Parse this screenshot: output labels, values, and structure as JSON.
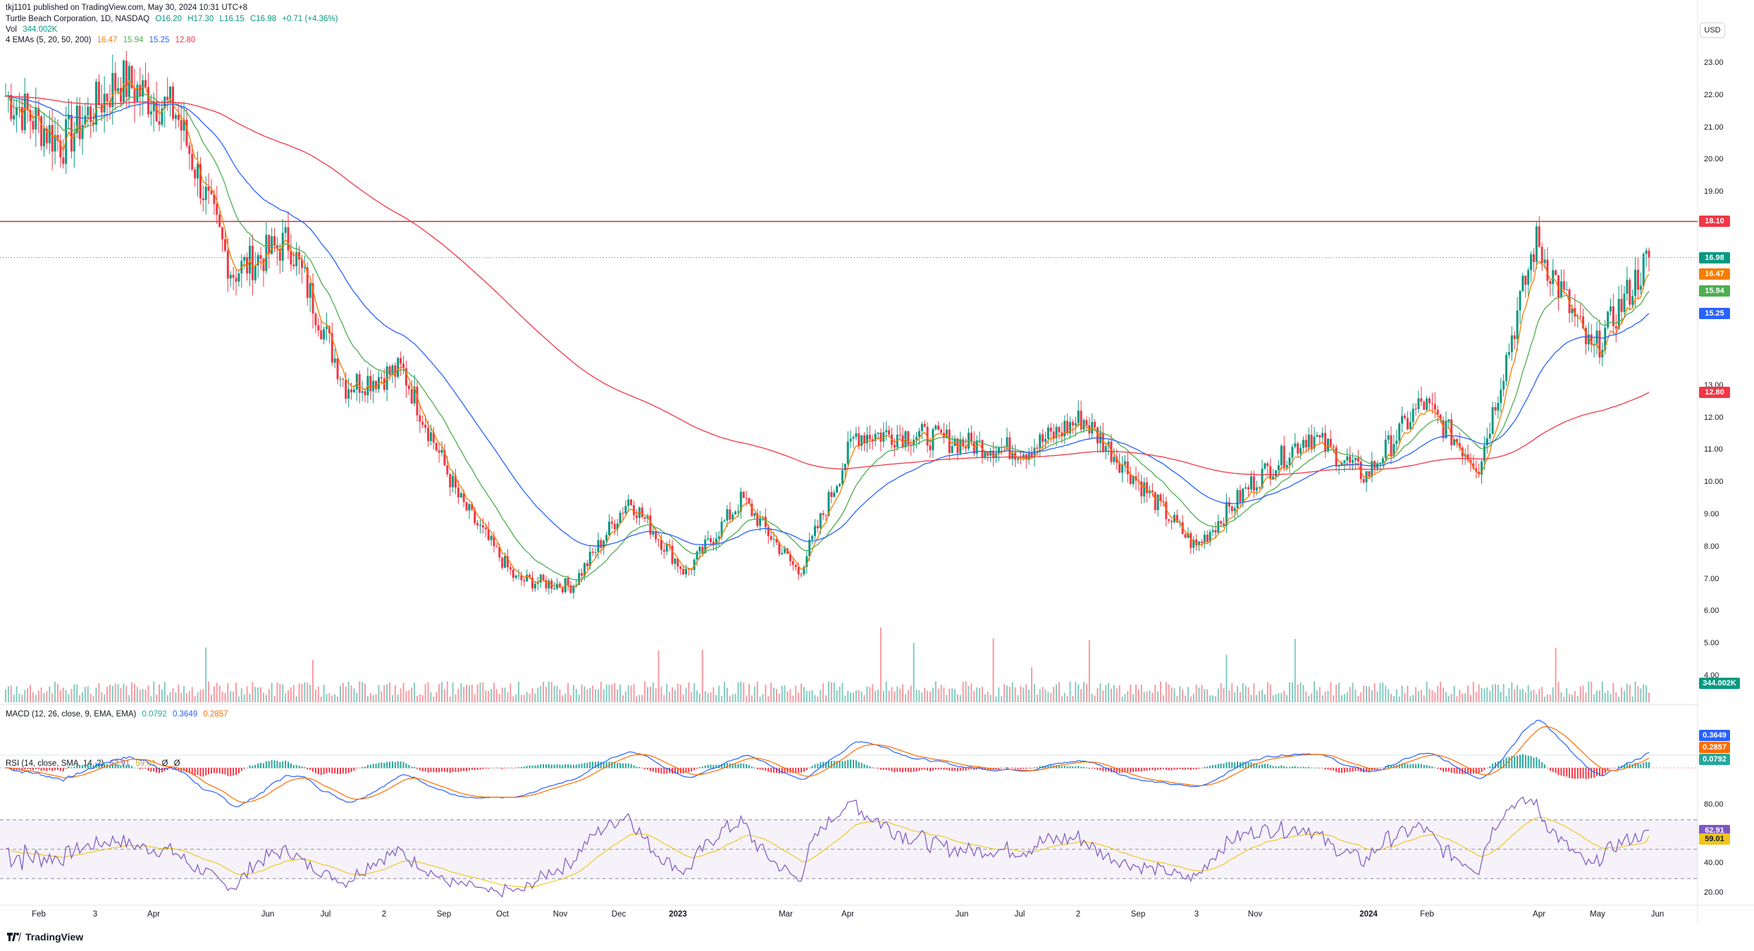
{
  "publisher_line": "tkj1101 published on TradingView.com, May 30, 2024 10:31 UTC+8",
  "symbol_line": {
    "name": "Turtle Beach Corporation, 1D, NASDAQ",
    "o": "O16.20",
    "h": "H17.30",
    "l": "L16.15",
    "c": "C16.98",
    "chg": "+0.71 (+4.36%)"
  },
  "vol_line": {
    "label": "Vol",
    "value": "344.002K"
  },
  "ema_line": {
    "label": "4 EMAs (5, 20, 50, 200)",
    "values": [
      "16.47",
      "15.94",
      "15.25",
      "12.80"
    ],
    "colors": [
      "#f57c00",
      "#4caf50",
      "#2962ff",
      "#f23645"
    ]
  },
  "macd_line": {
    "label": "MACD (12, 26, close, 9, EMA, EMA)",
    "values": [
      "0.0792",
      "0.3649",
      "0.2857"
    ],
    "colors": [
      "#26a69a",
      "#2962ff",
      "#ff6d00"
    ]
  },
  "rsi_line": {
    "label": "RSI (14, close, SMA, 14, 2)",
    "values": [
      "62.91",
      "59.01",
      "Ø",
      "Ø"
    ],
    "colors": [
      "#7e57c2",
      "#f0c419",
      "#131722",
      "#131722"
    ]
  },
  "currency": "USD",
  "price_axis_ticks": [
    "23.00",
    "22.00",
    "21.00",
    "20.00",
    "19.00",
    "13.00",
    "12.00",
    "11.00",
    "10.00",
    "9.00",
    "8.00",
    "7.00",
    "6.00",
    "5.00",
    "4.00"
  ],
  "price_pills": [
    {
      "label": "18.10",
      "color": "#f23645"
    },
    {
      "label": "16.98",
      "color": "#089981"
    },
    {
      "label": "16.47",
      "color": "#f57c00"
    },
    {
      "label": "15.94",
      "color": "#4caf50"
    },
    {
      "label": "15.25",
      "color": "#2962ff"
    },
    {
      "label": "12.80",
      "color": "#f23645"
    },
    {
      "label": "344.002K",
      "color": "#089981"
    }
  ],
  "macd_pills": [
    {
      "label": "0.3649",
      "color": "#2962ff"
    },
    {
      "label": "0.2857",
      "color": "#ff6d00"
    },
    {
      "label": "0.0792",
      "color": "#26a69a"
    }
  ],
  "rsi_axis_ticks": [
    "80.00",
    "40.00",
    "20.00"
  ],
  "rsi_pills": [
    {
      "label": "62.91",
      "color": "#7e57c2"
    },
    {
      "label": "59.01",
      "color": "#f0c419"
    }
  ],
  "x_axis": [
    {
      "label": "Feb",
      "bold": false
    },
    {
      "label": "3",
      "bold": false
    },
    {
      "label": "Apr",
      "bold": false
    },
    {
      "label": "Jun",
      "bold": false
    },
    {
      "label": "Jul",
      "bold": false
    },
    {
      "label": "2",
      "bold": false
    },
    {
      "label": "Sep",
      "bold": false
    },
    {
      "label": "Oct",
      "bold": false
    },
    {
      "label": "Nov",
      "bold": false
    },
    {
      "label": "Dec",
      "bold": false
    },
    {
      "label": "2023",
      "bold": true
    },
    {
      "label": "Mar",
      "bold": false
    },
    {
      "label": "Apr",
      "bold": false
    },
    {
      "label": "Jun",
      "bold": false
    },
    {
      "label": "Jul",
      "bold": false
    },
    {
      "label": "2",
      "bold": false
    },
    {
      "label": "Sep",
      "bold": false
    },
    {
      "label": "3",
      "bold": false
    },
    {
      "label": "Nov",
      "bold": false
    },
    {
      "label": "2024",
      "bold": true
    },
    {
      "label": "Feb",
      "bold": false
    },
    {
      "label": "Apr",
      "bold": false
    },
    {
      "label": "May",
      "bold": false
    },
    {
      "label": "Jun",
      "bold": false
    }
  ],
  "brand": "TradingView",
  "chart_data": {
    "type": "candlestick",
    "symbol": "Turtle Beach Corporation, 1D, NASDAQ",
    "horizontal_line": 18.1,
    "last_close": 16.98,
    "ylim": [
      4,
      23.5
    ],
    "close_path": [
      [
        "Jan 2022",
        22.0
      ],
      [
        "Feb 2022",
        20.5
      ],
      [
        "Mar 2022",
        22.5
      ],
      [
        "Apr 2022",
        21.5
      ],
      [
        "May 2022",
        16.5
      ],
      [
        "Jun 2022",
        17.5
      ],
      [
        "Jul 2022",
        13.0
      ],
      [
        "Aug 2022",
        13.5
      ],
      [
        "Sep 2022",
        9.5
      ],
      [
        "Oct 2022",
        7.0
      ],
      [
        "Nov 2022",
        6.8
      ],
      [
        "Dec 2022",
        9.5
      ],
      [
        "Jan 2023",
        7.2
      ],
      [
        "Feb 2023",
        9.5
      ],
      [
        "Mar 2023",
        7.2
      ],
      [
        "Apr 2023",
        11.5
      ],
      [
        "May 2023",
        11.5
      ],
      [
        "Jun 2023",
        11.2
      ],
      [
        "Jul 2023",
        11.0
      ],
      [
        "Aug 2023",
        12.0
      ],
      [
        "Sep 2023",
        10.0
      ],
      [
        "Oct 2023",
        8.0
      ],
      [
        "Nov 2023",
        10.0
      ],
      [
        "Dec 2023",
        11.5
      ],
      [
        "Jan 2024",
        10.2
      ],
      [
        "Feb 2024",
        12.5
      ],
      [
        "Mar 2024",
        10.5
      ],
      [
        "Apr 2024",
        17.5
      ],
      [
        "May 2024",
        14.0
      ],
      [
        "Jun 2024",
        16.98
      ]
    ],
    "emas": [
      {
        "name": "EMA 5",
        "last": 16.47
      },
      {
        "name": "EMA 20",
        "last": 15.94
      },
      {
        "name": "EMA 50",
        "last": 15.25
      },
      {
        "name": "EMA 200",
        "last": 12.8
      }
    ],
    "volume_last": "344.002K",
    "macd": {
      "macd": 0.3649,
      "signal": 0.2857,
      "hist": 0.0792
    },
    "rsi": {
      "rsi": 62.91,
      "sma": 59.01,
      "upper": 70,
      "lower": 30,
      "ylim": [
        20,
        80
      ]
    }
  }
}
